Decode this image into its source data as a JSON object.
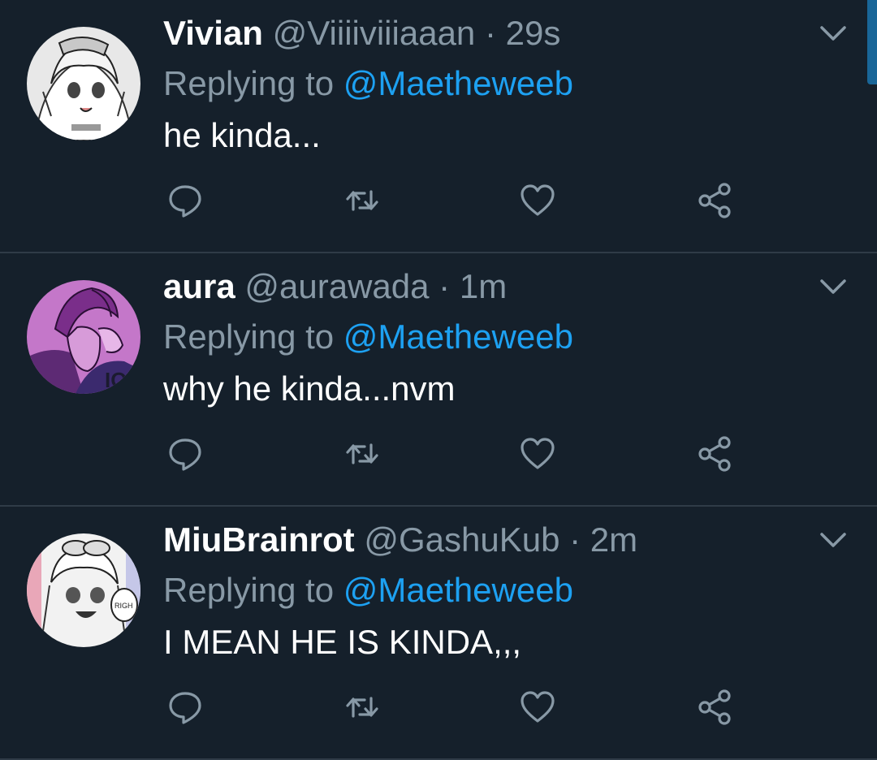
{
  "replying_prefix": "Replying to",
  "accent_color": "#1da1f2",
  "tweets": [
    {
      "display_name": "Vivian",
      "handle": "@Viiiiviiiaaan",
      "separator": "·",
      "time": "29s",
      "reply_to": "@Maetheweeb",
      "text": "he kinda...",
      "avatar": "avatar-manga-girl-grayscale"
    },
    {
      "display_name": "aura",
      "handle": "@aurawada",
      "separator": "·",
      "time": "1m",
      "reply_to": "@Maetheweeb",
      "text": "why he kinda...nvm",
      "avatar": "avatar-anime-boy-purple"
    },
    {
      "display_name": "MiuBrainrot",
      "handle": "@GashuKub",
      "separator": "·",
      "time": "2m",
      "reply_to": "@Maetheweeb",
      "text": "I MEAN HE IS KINDA,,,",
      "avatar": "avatar-manga-girl-goggles"
    }
  ],
  "icons": {
    "reply": "reply-icon",
    "retweet": "retweet-icon",
    "like": "like-icon",
    "share": "share-icon",
    "menu": "chevron-down-icon"
  }
}
